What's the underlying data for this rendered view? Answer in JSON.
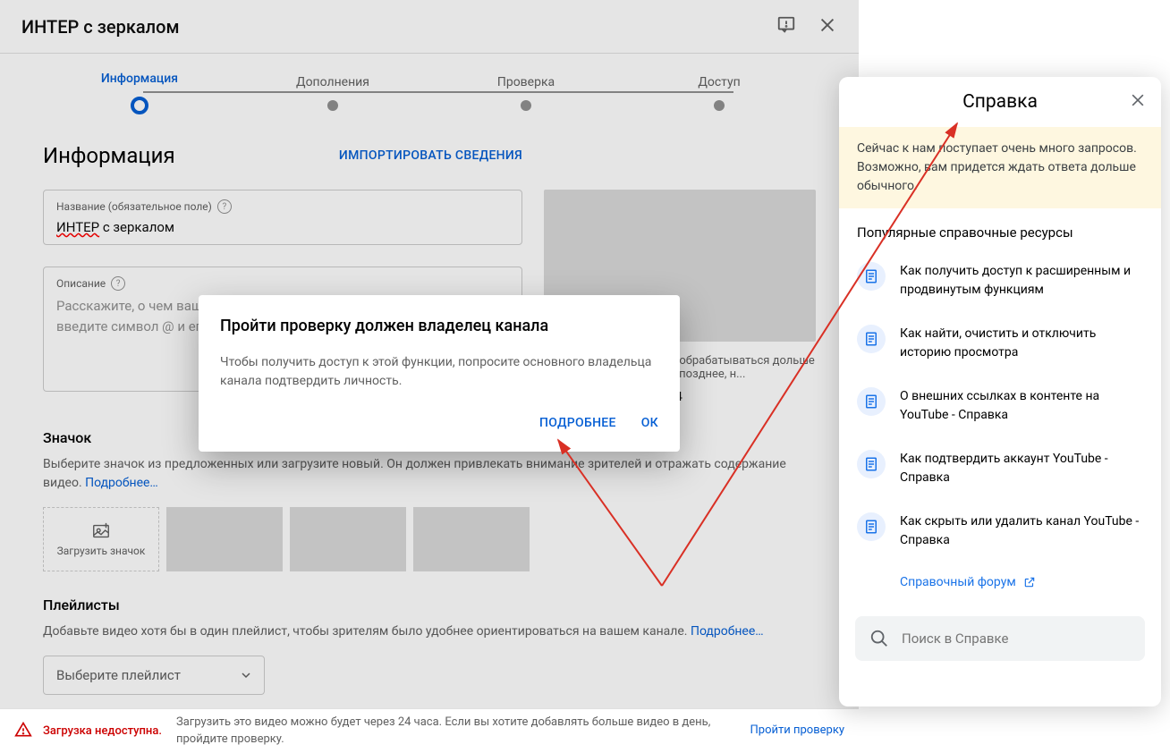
{
  "header": {
    "title": "ИНТЕР с зеркалом"
  },
  "stepper": {
    "steps": [
      "Информация",
      "Дополнения",
      "Проверка",
      "Доступ"
    ]
  },
  "info": {
    "heading": "Информация",
    "import_button": "ИМПОРТИРОВАТЬ СВЕДЕНИЯ",
    "title_field": {
      "label": "Название (обязательное поле)",
      "value_wavy": "ИНТЕР",
      "value_rest": " с зеркалом"
    },
    "desc_field": {
      "label": "Описание",
      "placeholder": "Расскажите, о чем ваше видео. Чтобы добавить упоминание автора, введите символ @ и его название канала."
    },
    "video": {
      "caption": "Ссылка на видео может обрабатываться дольше обычного. Проверьте ее позднее, н...",
      "filename": "ИНТЕР с зеркалом.mp4"
    },
    "thumbnail": {
      "title": "Значок",
      "desc": "Выберите значок из предложенных или загрузите новый. Он должен привлекать внимание зрителей и отражать содержание видео. ",
      "more": "Подробнее…",
      "upload": "Загрузить значок"
    },
    "playlist": {
      "title": "Плейлисты",
      "desc": "Добавьте видео хотя бы в один плейлист, чтобы зрителям было удобнее ориентироваться на вашем канале. ",
      "more": "Подробнее…",
      "select": "Выберите плейлист"
    }
  },
  "banner": {
    "warn": "Загрузка недоступна.",
    "desc": "Загрузить это видео можно будет через 24 часа. Если вы хотите добавлять больше видео в день, пройдите проверку.",
    "link": "Пройти проверку"
  },
  "modal": {
    "title": "Пройти проверку должен владелец канала",
    "body": "Чтобы получить доступ к этой функции, попросите основного владельца канала подтвердить личность.",
    "more": "ПОДРОБНЕЕ",
    "ok": "ОК"
  },
  "help": {
    "title": "Справка",
    "notice": "Сейчас к нам поступает очень много запросов. Возможно, вам придется ждать ответа дольше обычного.",
    "section": "Популярные справочные ресурсы",
    "items": [
      "Как получить доступ к расширенным и продвинутым функциям",
      "Как найти, очистить и отключить историю просмотра",
      "О внешних ссылках в контенте на YouTube - Справка",
      "Как подтвердить аккаунт YouTube - Справка",
      "Как скрыть или удалить канал YouTube - Справка"
    ],
    "forum": "Справочный форум",
    "search_placeholder": "Поиск в Справке"
  }
}
